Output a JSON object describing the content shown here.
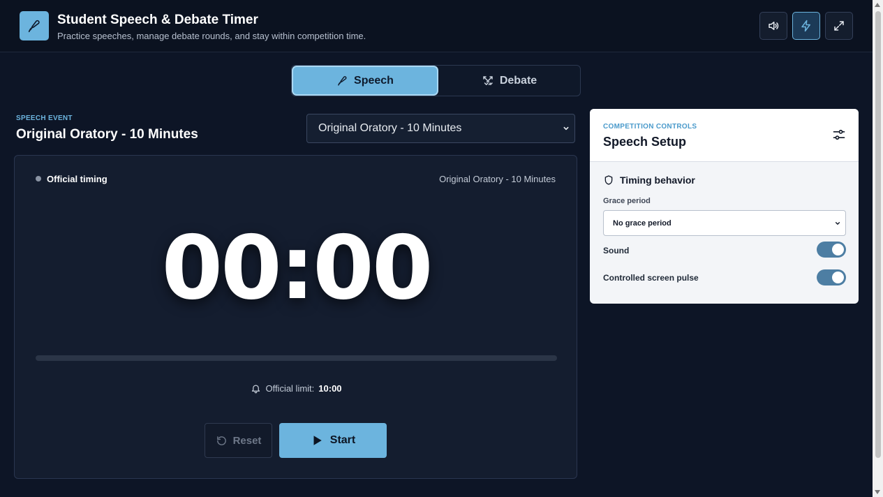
{
  "header": {
    "title": "Student Speech & Debate Timer",
    "subtitle": "Practice speeches, manage debate rounds, and stay within competition time.",
    "logo_icon": "pen-nib-icon",
    "buttons": [
      {
        "icon": "volume-icon"
      },
      {
        "icon": "lightning-icon",
        "active": true
      },
      {
        "icon": "fullscreen-icon"
      }
    ]
  },
  "mode_tabs": {
    "speech_label": "Speech",
    "debate_label": "Debate",
    "selected": "Speech"
  },
  "event": {
    "eyebrow": "SPEECH EVENT",
    "title": "Original Oratory - 10 Minutes",
    "selected_option": "Original Oratory - 10 Minutes"
  },
  "timer": {
    "status_label": "Official timing",
    "event_name": "Original Oratory - 10 Minutes",
    "display": "00:00",
    "progress": 0,
    "limit_label": "Official limit:",
    "limit_value": "10:00",
    "reset_label": "Reset",
    "start_label": "Start"
  },
  "panel": {
    "eyebrow": "COMPETITION CONTROLS",
    "title": "Speech Setup",
    "section_title": "Timing behavior",
    "grace_label": "Grace period",
    "grace_value": "No grace period",
    "sound_label": "Sound",
    "sound_on": true,
    "pulse_label": "Controlled screen pulse",
    "pulse_on": true
  },
  "colors": {
    "accent": "#6cb4de",
    "background": "#0d1526",
    "card": "#141d2f",
    "toggle_on": "#4d7ea3"
  }
}
